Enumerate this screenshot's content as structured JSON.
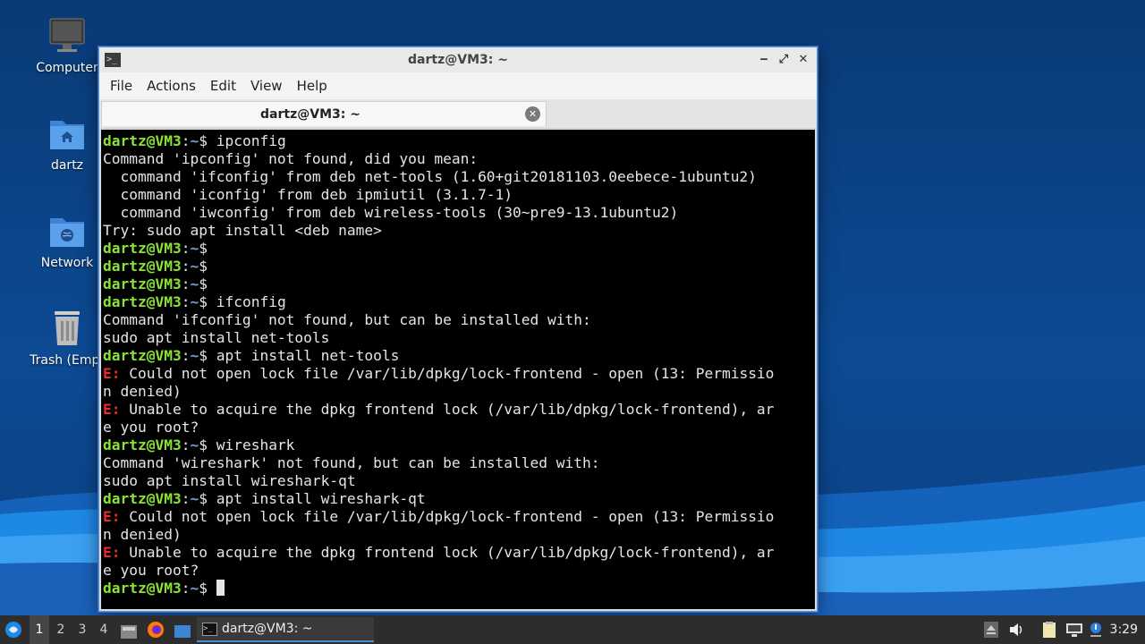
{
  "desktop": {
    "icons": [
      {
        "label": "Computer",
        "icon": "computer-icon"
      },
      {
        "label": "dartz",
        "icon": "home-folder-icon"
      },
      {
        "label": "Network",
        "icon": "network-folder-icon"
      },
      {
        "label": "Trash (Empt",
        "icon": "trash-icon"
      }
    ]
  },
  "window": {
    "title": "dartz@VM3: ~",
    "controls": {
      "minimize": "‒",
      "maximize": "⤢",
      "close": "✕"
    },
    "menu": [
      "File",
      "Actions",
      "Edit",
      "View",
      "Help"
    ],
    "tab": {
      "label": "dartz@VM3: ~",
      "close": "✕"
    }
  },
  "terminal": {
    "prompt_user": "dartz@VM3",
    "prompt_path": ":~",
    "prompt_sym": "$ ",
    "lines": [
      {
        "type": "prompt",
        "cmd": "ipconfig"
      },
      {
        "type": "out",
        "text": "Command 'ipconfig' not found, did you mean:"
      },
      {
        "type": "out",
        "text": "  command 'ifconfig' from deb net-tools (1.60+git20181103.0eebece-1ubuntu2)"
      },
      {
        "type": "out",
        "text": "  command 'iconfig' from deb ipmiutil (3.1.7-1)"
      },
      {
        "type": "out",
        "text": "  command 'iwconfig' from deb wireless-tools (30~pre9-13.1ubuntu2)"
      },
      {
        "type": "out",
        "text": "Try: sudo apt install <deb name>"
      },
      {
        "type": "prompt",
        "cmd": ""
      },
      {
        "type": "prompt",
        "cmd": ""
      },
      {
        "type": "prompt",
        "cmd": ""
      },
      {
        "type": "prompt",
        "cmd": "ifconfig"
      },
      {
        "type": "out",
        "text": "Command 'ifconfig' not found, but can be installed with:"
      },
      {
        "type": "out",
        "text": "sudo apt install net-tools"
      },
      {
        "type": "prompt",
        "cmd": "apt install net-tools"
      },
      {
        "type": "err",
        "text": " Could not open lock file /var/lib/dpkg/lock-frontend - open (13: Permissio"
      },
      {
        "type": "out",
        "text": "n denied)"
      },
      {
        "type": "err",
        "text": " Unable to acquire the dpkg frontend lock (/var/lib/dpkg/lock-frontend), ar"
      },
      {
        "type": "out",
        "text": "e you root?"
      },
      {
        "type": "prompt",
        "cmd": "wireshark"
      },
      {
        "type": "out",
        "text": "Command 'wireshark' not found, but can be installed with:"
      },
      {
        "type": "out",
        "text": "sudo apt install wireshark-qt"
      },
      {
        "type": "prompt",
        "cmd": "apt install wireshark-qt"
      },
      {
        "type": "err",
        "text": " Could not open lock file /var/lib/dpkg/lock-frontend - open (13: Permissio"
      },
      {
        "type": "out",
        "text": "n denied)"
      },
      {
        "type": "err",
        "text": " Unable to acquire the dpkg frontend lock (/var/lib/dpkg/lock-frontend), ar"
      },
      {
        "type": "out",
        "text": "e you root?"
      },
      {
        "type": "prompt",
        "cmd": "",
        "cursor": true
      }
    ],
    "err_prefix": "E:"
  },
  "taskbar": {
    "workspaces": [
      "1",
      "2",
      "3",
      "4"
    ],
    "active_workspace": "1",
    "task_label": "dartz@VM3: ~",
    "clock": "3:29"
  },
  "colors": {
    "prompt_user": "#8ae234",
    "prompt_path": "#729fcf",
    "error": "#ef2929",
    "accent": "#4b8fd9"
  }
}
